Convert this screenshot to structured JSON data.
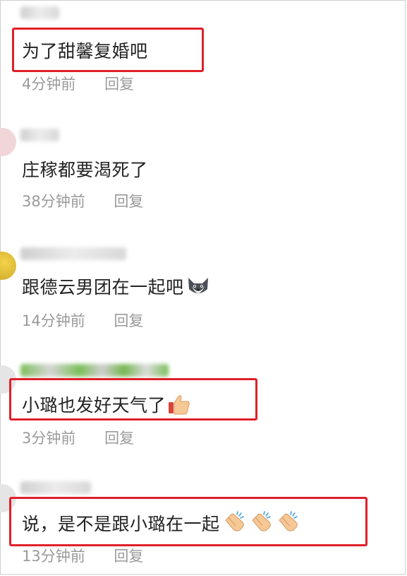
{
  "comments": [
    {
      "text": "为了甜馨复婚吧",
      "time": "4分钟前",
      "reply": "回复",
      "emojis": []
    },
    {
      "text": "庄稼都要渴死了",
      "time": "38分钟前",
      "reply": "回复",
      "emojis": []
    },
    {
      "text": "跟德云男团在一起吧",
      "time": "14分钟前",
      "reply": "回复",
      "emojis": [
        "husky-face-emoji"
      ]
    },
    {
      "text": "小璐也发好天气了",
      "time": "3分钟前",
      "reply": "回复",
      "emojis": [
        "thumbs-up-emoji"
      ]
    },
    {
      "text": "说，是不是跟小璐在一起",
      "time": "13分钟前",
      "reply": "回复",
      "emojis": [
        "clapping-hands-emoji",
        "clapping-hands-emoji",
        "clapping-hands-emoji"
      ]
    }
  ],
  "highlight_color": "#e0202a"
}
